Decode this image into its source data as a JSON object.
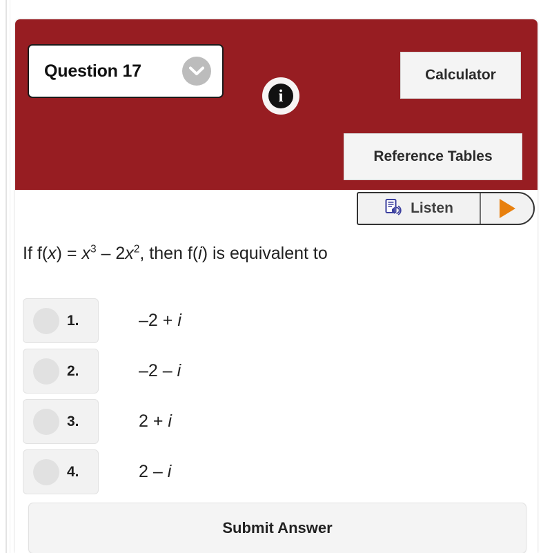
{
  "header": {
    "background_color": "#971d22",
    "question_selector": {
      "label": "Question 17",
      "chevron_icon": "chevron-down-icon"
    },
    "info_icon": {
      "glyph": "i",
      "name": "info-icon"
    },
    "calculator_button": "Calculator",
    "reference_tables_button": "Reference Tables"
  },
  "toolbar": {
    "listen_label": "Listen",
    "listen_icon": "document-speaker-icon",
    "play_icon": "play-triangle-icon",
    "play_color": "#e8800e"
  },
  "question": {
    "prefix": "If f(",
    "var1": "x",
    "mid1": ") = ",
    "var2": "x",
    "exp1": "3",
    "mid2": " – 2",
    "var3": "x",
    "exp2": "2",
    "mid3": ", then f(",
    "var4": "i",
    "suffix": ") is equivalent to",
    "plain_text": "If f(x) = x3 – 2x2, then f(i) is equivalent to"
  },
  "choices": [
    {
      "number": "1.",
      "real": "–2 + ",
      "imaginary": "i",
      "text": "–2 + i"
    },
    {
      "number": "2.",
      "real": "–2 – ",
      "imaginary": "i",
      "text": "–2 – i"
    },
    {
      "number": "3.",
      "real": "2 + ",
      "imaginary": "i",
      "text": "2 + i"
    },
    {
      "number": "4.",
      "real": "2 – ",
      "imaginary": "i",
      "text": "2 – i"
    }
  ],
  "submit": {
    "label": "Submit Answer"
  }
}
